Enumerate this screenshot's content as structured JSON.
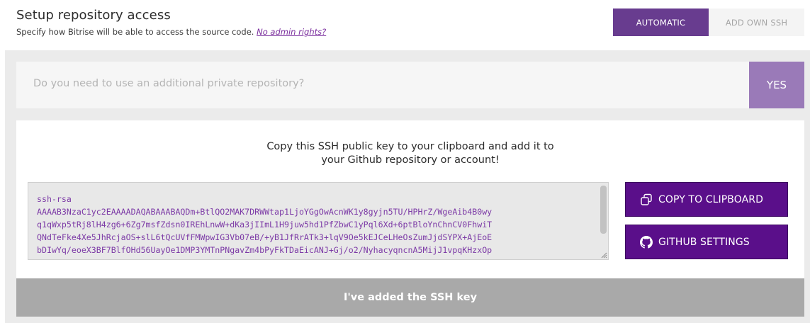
{
  "header": {
    "title": "Setup repository access",
    "subtitle": "Specify how Bitrise will be able to access the source code.",
    "no_admin_link": "No admin rights?",
    "toggle": {
      "automatic_label": "AUTOMATIC",
      "add_own_ssh_label": "ADD OWN SSH",
      "selected": "AUTOMATIC"
    }
  },
  "private_repo": {
    "question": "Do you need to use an additional private repository?",
    "yes_label": "YES"
  },
  "ssh_panel": {
    "instruction_line1": "Copy this SSH public key to your clipboard and add it to",
    "instruction_line2": "your Github repository or account!",
    "key_text": "ssh-rsa\nAAAAB3NzaC1yc2EAAAADAQABAAABAQDm+BtlQO2MAK7DRWWtap1LjoYGgOwAcnWK1y8gyjn5TU/HPHrZ/WgeAib4B0wy\nq1qWxp5tRj8lH4zg6+6Zg7msfZdsn0IREhLnwW+dKa3jIImL1H9juw5hd1PfZbwC1yPql6Xd+6ptBloYnChnCV0FhwiT\nQNdTeFke4Xe5JhRcjaOS+slL6tQcUVfFMWpwIG3Vb07eB/+yB1JfRrATk3+lqV9Oe5kEJCeLHeOsZumJjdSYPX+AjEoE\nbDIwYq/eoeX3BF7BlfOHd56UayOe1DMP3YMTnPNgavZm4bPyFkTDaEicANJ+Gj/o2/NyhacyqncnA5MijJ1vpqKHzxOp",
    "copy_label": "COPY TO CLIPBOARD",
    "github_label": "GITHUB SETTINGS"
  },
  "confirm": {
    "label": "I've added the SSH key"
  },
  "colors": {
    "primary_purple": "#5a0f8a",
    "toggle_active": "#683c8f",
    "yes_button": "#9a7ab8",
    "link": "#7b2f9e",
    "key_text": "#7c3aa6",
    "confirm_disabled": "#a9a9a9"
  },
  "icons": {
    "copy": "copy-icon",
    "github": "github-icon"
  }
}
